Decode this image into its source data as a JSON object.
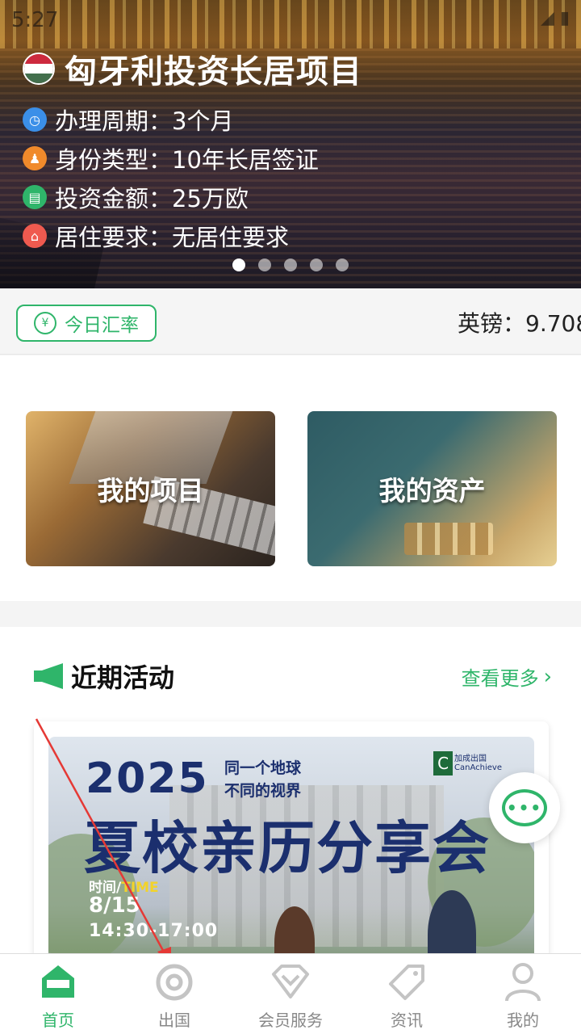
{
  "status_bar": {
    "time": "5:27",
    "right": "◢ ▮"
  },
  "hero": {
    "title": "匈牙利投资长居项目",
    "flag_colors": [
      "#cd2a3e",
      "#ffffff",
      "#436f4d"
    ],
    "rows": [
      {
        "label": "办理周期：",
        "value": "3个月",
        "icon": "clock-icon",
        "color": "#3b8fe8"
      },
      {
        "label": "身份类型：",
        "value": "10年长居签证",
        "icon": "person-icon",
        "color": "#f08a2b"
      },
      {
        "label": "投资金额：",
        "value": "25万欧",
        "icon": "money-icon",
        "color": "#2fb56a"
      },
      {
        "label": "居住要求：",
        "value": "无居住要求",
        "icon": "home-icon",
        "color": "#ef5a4f"
      }
    ],
    "slide_count": 5,
    "active_slide": 0
  },
  "rate": {
    "button_label": "今日汇率",
    "ticker": "英镑：9.708"
  },
  "cards": {
    "project_label": "我的项目",
    "asset_label": "我的资产"
  },
  "activity": {
    "title": "近期活动",
    "more_label": "查看更多",
    "poster": {
      "year": "2025",
      "sub1": "同一个地球",
      "sub2": "不同的视界",
      "logo_line1": "加成出国",
      "logo_line2": "CanAchieve",
      "headline": "夏校亲历分享会",
      "time_label": "时间/",
      "time_label_en": "TIME",
      "date": "8/15",
      "hours": "14:30-17:00"
    }
  },
  "support_label": "•••",
  "tabs": [
    {
      "label": "首页",
      "icon": "home-tab-icon",
      "active": true
    },
    {
      "label": "出国",
      "icon": "target-icon",
      "active": false
    },
    {
      "label": "会员服务",
      "icon": "diamond-icon",
      "active": false
    },
    {
      "label": "资讯",
      "icon": "tag-icon",
      "active": false
    },
    {
      "label": "我的",
      "icon": "user-icon",
      "active": false
    }
  ],
  "colors": {
    "brand_green": "#2fb56a",
    "annotation_red": "#e53935",
    "navy": "#1b2f6e"
  }
}
